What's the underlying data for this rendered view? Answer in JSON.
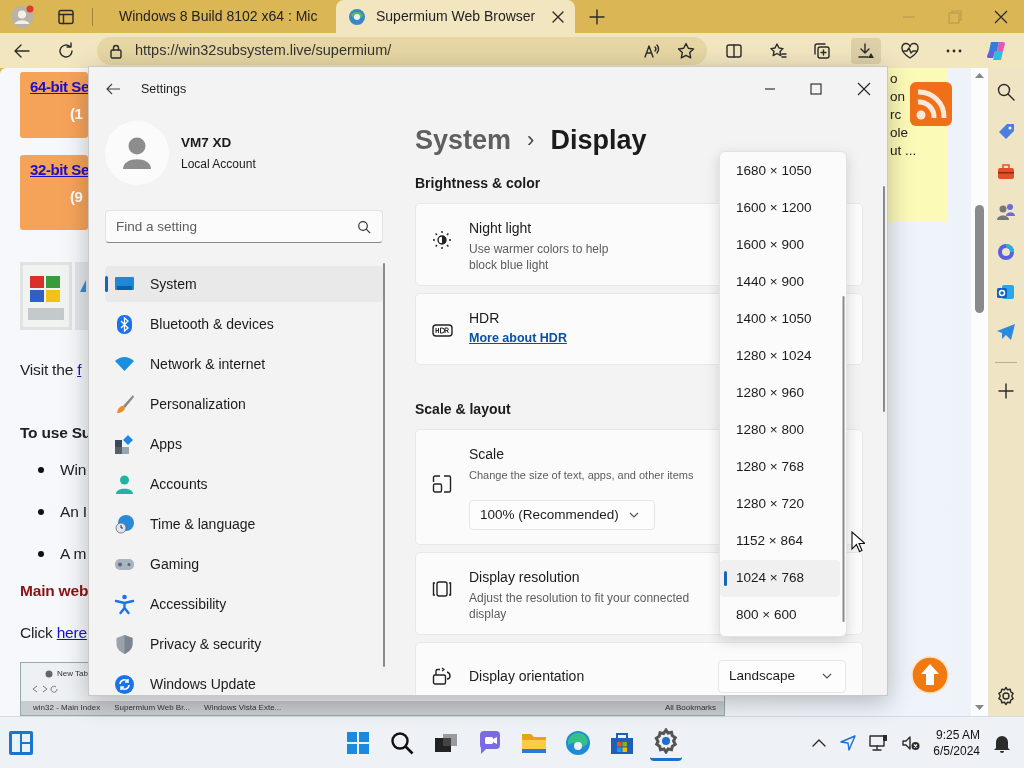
{
  "browser": {
    "tabs": [
      {
        "title": "Windows 8 Build 8102 x64 : Mic",
        "selected": false
      },
      {
        "title": "Supermium Web Browser",
        "selected": true
      }
    ],
    "url": "https://win32subsystem.live/supermium/",
    "webpage": {
      "downloads": [
        {
          "link": "64-bit Se",
          "size": "(1"
        },
        {
          "link": "32-bit Se",
          "size": "(9"
        }
      ],
      "visit": {
        "text": "Visit the",
        "link": "f"
      },
      "requirements_heading": "To use Su",
      "requirements": [
        "Win",
        "An I",
        "A m"
      ],
      "main_site": "Main web",
      "click": {
        "text": "Click",
        "link": "here"
      },
      "screenshot": {
        "tab": "New Tab",
        "bookmarks": [
          "win32 - Main Index",
          "Supermium Web Br...",
          "Windows Vista Exte..."
        ],
        "all_bookmarks": "All Bookmarks"
      },
      "note_lines": [
        "o",
        "on",
        "rc",
        "ole",
        "ut ..."
      ]
    }
  },
  "settings": {
    "title": "Settings",
    "account": {
      "name": "VM7 XD",
      "type": "Local Account"
    },
    "search": {
      "placeholder": "Find a setting"
    },
    "nav": [
      {
        "label": "System",
        "selected": true
      },
      {
        "label": "Bluetooth & devices",
        "selected": false
      },
      {
        "label": "Network & internet",
        "selected": false
      },
      {
        "label": "Personalization",
        "selected": false
      },
      {
        "label": "Apps",
        "selected": false
      },
      {
        "label": "Accounts",
        "selected": false
      },
      {
        "label": "Time & language",
        "selected": false
      },
      {
        "label": "Gaming",
        "selected": false
      },
      {
        "label": "Accessibility",
        "selected": false
      },
      {
        "label": "Privacy & security",
        "selected": false
      },
      {
        "label": "Windows Update",
        "selected": false
      }
    ],
    "breadcrumb": {
      "parent": "System",
      "separator": "›",
      "current": "Display"
    },
    "sections": [
      {
        "heading": "Brightness & color",
        "items": [
          {
            "kind": "plain",
            "title": "Night light",
            "description": "Use warmer colors to help block blue light"
          },
          {
            "kind": "link",
            "title": "HDR",
            "link": "More about HDR"
          }
        ]
      },
      {
        "heading": "Scale & layout",
        "items": [
          {
            "kind": "dropdown",
            "title": "Scale",
            "description": "Change the size of text, apps, and other items",
            "value": "100% (Recommended)"
          },
          {
            "kind": "plain",
            "title": "Display resolution",
            "description": "Adjust the resolution to fit your connected display"
          },
          {
            "kind": "side_dropdown",
            "title": "Display orientation",
            "value": "Landscape"
          }
        ]
      }
    ],
    "resolution_menu": {
      "options": [
        {
          "label": "1680 × 1050",
          "selected": false
        },
        {
          "label": "1600 × 1200",
          "selected": false
        },
        {
          "label": "1600 × 900",
          "selected": false
        },
        {
          "label": "1440 × 900",
          "selected": false
        },
        {
          "label": "1400 × 1050",
          "selected": false
        },
        {
          "label": "1280 × 1024",
          "selected": false
        },
        {
          "label": "1280 × 960",
          "selected": false
        },
        {
          "label": "1280 × 800",
          "selected": false
        },
        {
          "label": "1280 × 768",
          "selected": false
        },
        {
          "label": "1280 × 720",
          "selected": false
        },
        {
          "label": "1152 × 864",
          "selected": false
        },
        {
          "label": "1024 × 768",
          "selected": true
        },
        {
          "label": "800 × 600",
          "selected": false
        }
      ]
    }
  },
  "taskbar": {
    "time": "9:25 AM",
    "date": "6/5/2024"
  }
}
